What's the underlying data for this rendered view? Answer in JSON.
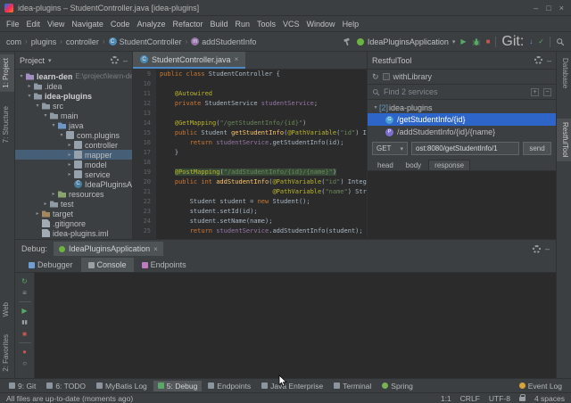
{
  "window": {
    "title": "idea-plugins – StudentController.java [idea-plugins]",
    "controls": {
      "minimize": "–",
      "maximize": "□",
      "close": "×"
    }
  },
  "menu": {
    "items": [
      "File",
      "Edit",
      "View",
      "Navigate",
      "Code",
      "Analyze",
      "Refactor",
      "Build",
      "Run",
      "Tools",
      "VCS",
      "Window",
      "Help"
    ]
  },
  "navbar": {
    "breadcrumbs": [
      {
        "label": "com"
      },
      {
        "label": "plugins"
      },
      {
        "label": "controller"
      },
      {
        "label": "StudentController",
        "icon": "class"
      },
      {
        "label": "addStudentInfo",
        "icon": "method"
      }
    ],
    "run_config": "IdeaPluginsApplication",
    "git_label": "Git:"
  },
  "left_strip": {
    "top": [
      {
        "label": "1: Project",
        "active": true
      },
      {
        "label": "7: Structure"
      }
    ],
    "bottom": [
      {
        "label": "Web"
      },
      {
        "label": "2: Favorites"
      }
    ]
  },
  "right_strip": {
    "top": [
      {
        "label": "Database"
      }
    ],
    "middle": [
      {
        "label": "RestfulTool",
        "active": true
      }
    ]
  },
  "project": {
    "title": "Project",
    "tree": [
      {
        "label": "learn-demo",
        "hint": "E:\\project\\learn-demo",
        "level": 0,
        "icon": "project",
        "expanded": true,
        "bold": true
      },
      {
        "label": ".idea",
        "level": 1,
        "icon": "folder",
        "expanded": false
      },
      {
        "label": "idea-plugins",
        "level": 1,
        "icon": "module",
        "expanded": true,
        "bold": true
      },
      {
        "label": "src",
        "level": 2,
        "icon": "folder",
        "expanded": true
      },
      {
        "label": "main",
        "level": 3,
        "icon": "folder",
        "expanded": true
      },
      {
        "label": "java",
        "level": 4,
        "icon": "srcfolder",
        "expanded": true
      },
      {
        "label": "com.plugins",
        "level": 5,
        "icon": "package",
        "expanded": true
      },
      {
        "label": "controller",
        "level": 6,
        "icon": "package",
        "expanded": false
      },
      {
        "label": "mapper",
        "level": 6,
        "icon": "package",
        "expanded": false,
        "selected": true
      },
      {
        "label": "model",
        "level": 6,
        "icon": "package",
        "expanded": false
      },
      {
        "label": "service",
        "level": 6,
        "icon": "package",
        "expanded": false
      },
      {
        "label": "IdeaPluginsApplication",
        "level": 6,
        "icon": "class",
        "leaf": true
      },
      {
        "label": "resources",
        "level": 4,
        "icon": "resfolder",
        "expanded": false
      },
      {
        "label": "test",
        "level": 3,
        "icon": "folder",
        "expanded": false
      },
      {
        "label": "target",
        "level": 2,
        "icon": "exfolder",
        "expanded": false
      },
      {
        "label": ".gitignore",
        "level": 2,
        "icon": "file",
        "leaf": true
      },
      {
        "label": "idea-plugins.iml",
        "level": 2,
        "icon": "file",
        "leaf": true
      }
    ]
  },
  "editor": {
    "tab": "StudentController.java",
    "lines": [
      {
        "num": 9,
        "segments": [
          [
            "kw",
            "public class "
          ],
          [
            "plain",
            "StudentController {"
          ]
        ]
      },
      {
        "num": 10,
        "segments": []
      },
      {
        "num": 11,
        "segments": [
          [
            "ann",
            "    @Autowired"
          ]
        ]
      },
      {
        "num": 12,
        "segments": [
          [
            "kw",
            "    private "
          ],
          [
            "plain",
            "StudentService "
          ],
          [
            "field",
            "studentService"
          ],
          [
            "plain",
            ";"
          ]
        ]
      },
      {
        "num": 13,
        "segments": []
      },
      {
        "num": 14,
        "segments": [
          [
            "ann",
            "    @GetMapping"
          ],
          [
            "plain",
            "("
          ],
          [
            "str",
            "\"/getStudentInfo/{id}\""
          ],
          [
            "plain",
            ")"
          ]
        ]
      },
      {
        "num": 15,
        "segments": [
          [
            "kw",
            "    public "
          ],
          [
            "plain",
            "Student "
          ],
          [
            "method",
            "getStudentInfo"
          ],
          [
            "plain",
            "("
          ],
          [
            "ann",
            "@PathVariable"
          ],
          [
            "plain",
            "("
          ],
          [
            "str",
            "\"id\""
          ],
          [
            "plain",
            ") Integer id) {"
          ]
        ]
      },
      {
        "num": 16,
        "segments": [
          [
            "kw",
            "        return "
          ],
          [
            "field",
            "studentService"
          ],
          [
            "plain",
            ".getStudentInfo(id);"
          ]
        ]
      },
      {
        "num": 17,
        "segments": [
          [
            "plain",
            "    }"
          ]
        ]
      },
      {
        "num": 18,
        "segments": []
      },
      {
        "num": 19,
        "segments": [
          [
            "plain",
            "    "
          ],
          [
            "ann",
            "@PostMapping",
            true
          ],
          [
            "plain",
            "(",
            true
          ],
          [
            "str",
            "\"/addStudentInfo/{id}/{name}\"",
            true
          ],
          [
            "plain",
            ")",
            true
          ]
        ]
      },
      {
        "num": 20,
        "segments": [
          [
            "kw",
            "    public int "
          ],
          [
            "method",
            "addStudentInfo"
          ],
          [
            "plain",
            "("
          ],
          [
            "ann",
            "@PathVariable"
          ],
          [
            "plain",
            "("
          ],
          [
            "str",
            "\"id\""
          ],
          [
            "plain",
            ") Integer id,"
          ]
        ]
      },
      {
        "num": 21,
        "segments": [
          [
            "plain",
            "                              "
          ],
          [
            "ann",
            "@PathVariable"
          ],
          [
            "plain",
            "("
          ],
          [
            "str",
            "\"name\""
          ],
          [
            "plain",
            ") String name) {"
          ]
        ]
      },
      {
        "num": 22,
        "segments": [
          [
            "plain",
            "        Student student = "
          ],
          [
            "kw",
            "new "
          ],
          [
            "plain",
            "Student();"
          ]
        ]
      },
      {
        "num": 23,
        "segments": [
          [
            "plain",
            "        student.setId(id);"
          ]
        ]
      },
      {
        "num": 24,
        "segments": [
          [
            "plain",
            "        student.setName(name);"
          ]
        ]
      },
      {
        "num": 25,
        "segments": [
          [
            "kw",
            "        return "
          ],
          [
            "field",
            "studentService"
          ],
          [
            "plain",
            ".addStudentInfo(student);"
          ]
        ]
      }
    ]
  },
  "restful": {
    "title": "RestfulTool",
    "with_library_label": "withLibrary",
    "search_text": "Find 2 services",
    "root": {
      "count": "[2]",
      "name": "idea-plugins"
    },
    "services": [
      {
        "method": "GET",
        "path": "/getStudentInfo/{id}",
        "selected": true
      },
      {
        "method": "POST",
        "path": "/addStudentInfo/{id}/{name}"
      }
    ],
    "request": {
      "method": "GET",
      "url": "ost:8080/getStudentInfo/1",
      "send_label": "send"
    },
    "tabs": [
      {
        "label": "head"
      },
      {
        "label": "body"
      },
      {
        "label": "response",
        "active": true
      }
    ]
  },
  "debug": {
    "label": "Debug:",
    "session_tab": "IdeaPluginsApplication",
    "tabs": [
      {
        "label": "Debugger"
      },
      {
        "label": "Console",
        "active": true
      },
      {
        "label": "Endpoints"
      }
    ],
    "strip": [
      "rerun",
      "settings",
      "sep",
      "resume",
      "pause",
      "stop",
      "sep",
      "breakpoints",
      "mute"
    ]
  },
  "bottom_bar": {
    "items": [
      {
        "label": "9: Git",
        "icon": "git"
      },
      {
        "label": "6: TODO",
        "icon": "todo"
      },
      {
        "label": "MyBatis Log",
        "icon": "mybatis"
      },
      {
        "label": "5: Debug",
        "icon": "debug",
        "active": true
      },
      {
        "label": "Endpoints",
        "icon": "endpoints"
      },
      {
        "label": "Java Enterprise",
        "icon": "javaee"
      },
      {
        "label": "Terminal",
        "icon": "terminal"
      },
      {
        "label": "Spring",
        "icon": "spring"
      }
    ],
    "right_items": [
      {
        "label": "Event Log",
        "icon": "eventlog"
      }
    ]
  },
  "status_bar": {
    "message": "All files are up-to-date (moments ago)",
    "position": "1:1",
    "line_separator": "CRLF",
    "encoding": "UTF-8",
    "indent": "4 spaces"
  },
  "icons": {
    "close": "×",
    "minimize": "–",
    "maximize": "□",
    "dropdown": "▾",
    "expand": "▸",
    "collapse": "▾",
    "crumb_sep": "›",
    "class_letter": "C",
    "method_letter": "m",
    "play": "▶",
    "stop": "■",
    "check": "✓",
    "arrow_down": "↓",
    "rerun": "↻",
    "settings": "≡",
    "resume": "▶",
    "pause": "▮▮",
    "breakpoints": "●",
    "mute": "○",
    "plus": "+",
    "minus": "−"
  }
}
